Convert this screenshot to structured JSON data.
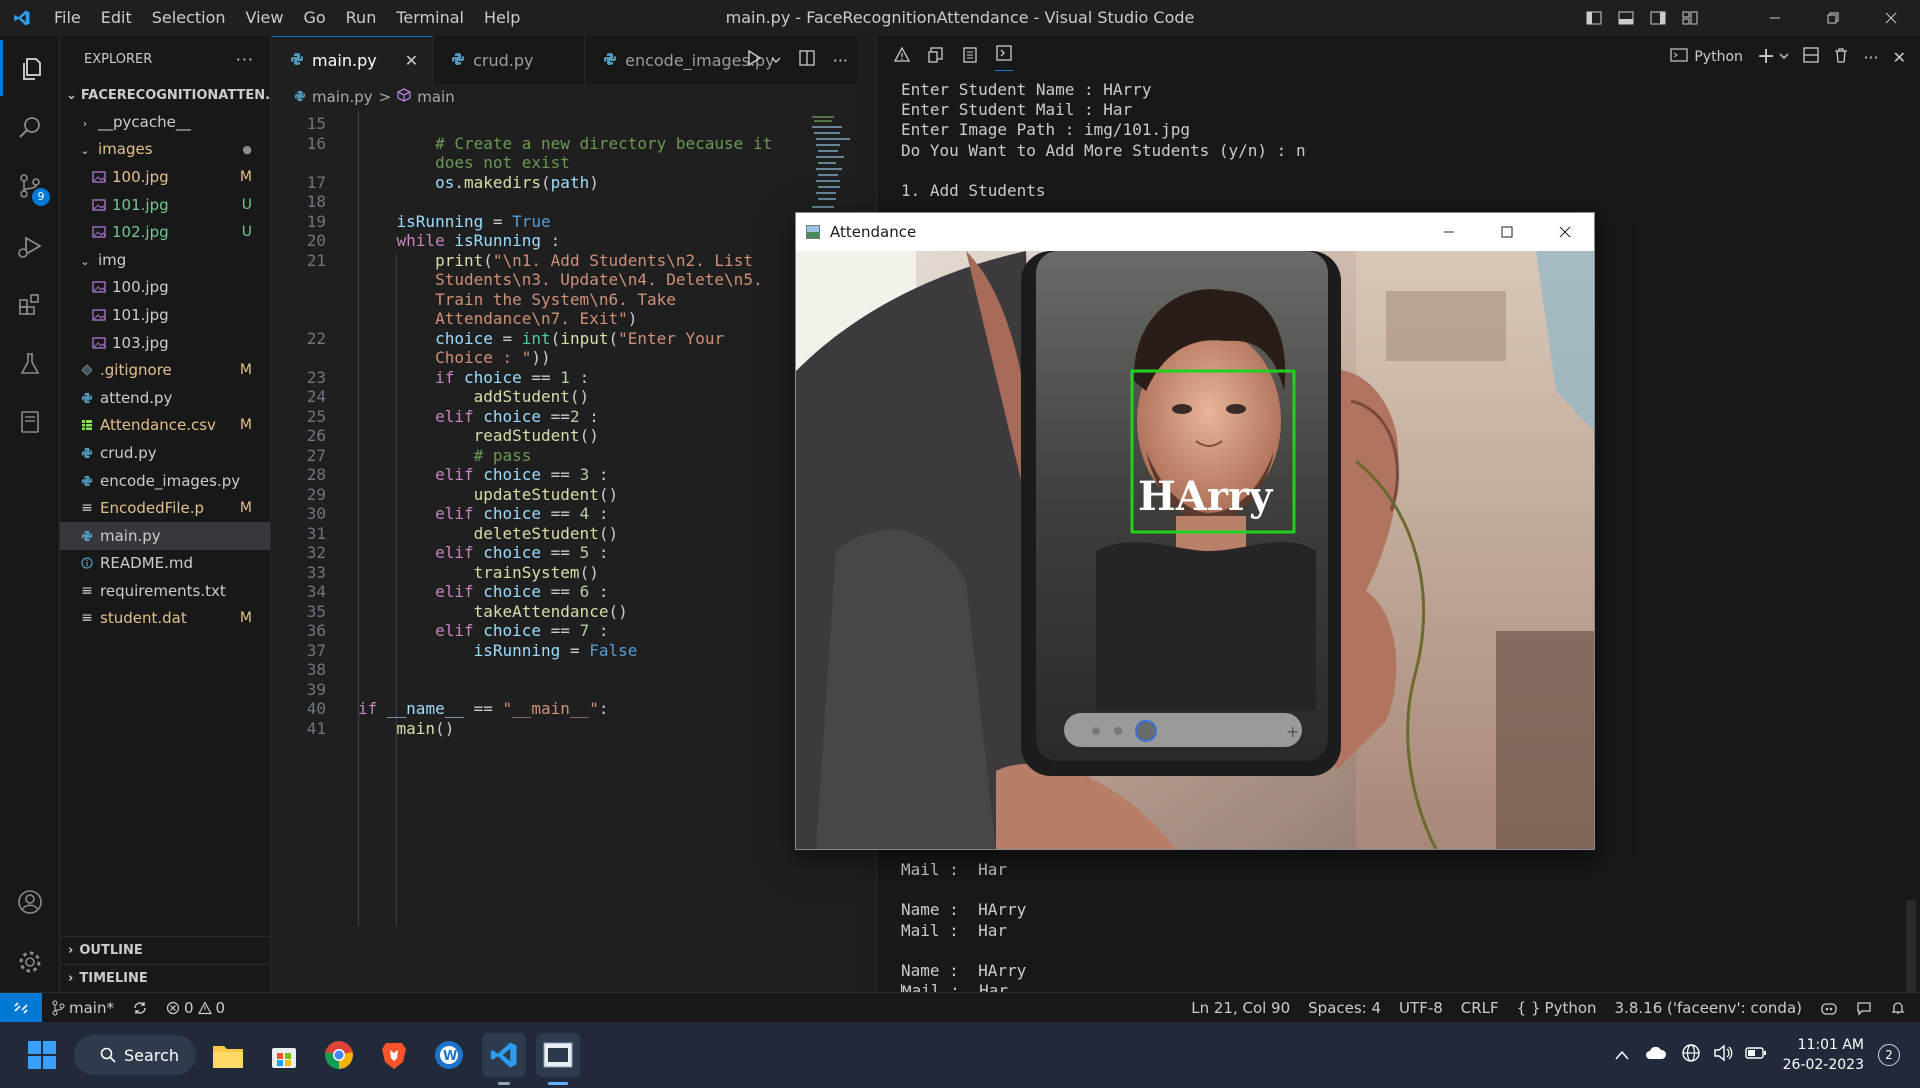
{
  "titlebar": {
    "menu": [
      "File",
      "Edit",
      "Selection",
      "View",
      "Go",
      "Run",
      "Terminal",
      "Help"
    ],
    "title": "main.py - FaceRecognitionAttendance - Visual Studio Code"
  },
  "activity": {
    "scm_badge": "9"
  },
  "explorer": {
    "header": "EXPLORER",
    "more": "···",
    "project": "FACERECOGNITIONATTEN...",
    "items": [
      {
        "label": "__pycache__",
        "status": "",
        "kind": "folder-closed",
        "color": "def"
      },
      {
        "label": "images",
        "status": "●",
        "kind": "folder-open",
        "color": "mod"
      },
      {
        "label": "100.jpg",
        "status": "M",
        "kind": "image",
        "color": "mod"
      },
      {
        "label": "101.jpg",
        "status": "U",
        "kind": "image",
        "color": "untr"
      },
      {
        "label": "102.jpg",
        "status": "U",
        "kind": "image",
        "color": "untr"
      },
      {
        "label": "img",
        "status": "",
        "kind": "folder-open",
        "color": "def"
      },
      {
        "label": "100.jpg",
        "status": "",
        "kind": "image",
        "color": "def"
      },
      {
        "label": "101.jpg",
        "status": "",
        "kind": "image",
        "color": "def"
      },
      {
        "label": "103.jpg",
        "status": "",
        "kind": "image",
        "color": "def"
      },
      {
        "label": ".gitignore",
        "status": "M",
        "kind": "git",
        "color": "mod"
      },
      {
        "label": "attend.py",
        "status": "",
        "kind": "python",
        "color": "def"
      },
      {
        "label": "Attendance.csv",
        "status": "M",
        "kind": "csv",
        "color": "mod"
      },
      {
        "label": "crud.py",
        "status": "",
        "kind": "python",
        "color": "def"
      },
      {
        "label": "encode_images.py",
        "status": "",
        "kind": "python",
        "color": "def"
      },
      {
        "label": "EncodedFile.p",
        "status": "M",
        "kind": "text",
        "color": "mod"
      },
      {
        "label": "main.py",
        "status": "",
        "kind": "python",
        "color": "def"
      },
      {
        "label": "README.md",
        "status": "",
        "kind": "info",
        "color": "def"
      },
      {
        "label": "requirements.txt",
        "status": "",
        "kind": "text",
        "color": "def"
      },
      {
        "label": "student.dat",
        "status": "M",
        "kind": "text",
        "color": "mod"
      }
    ],
    "outline": "OUTLINE",
    "timeline": "TIMELINE"
  },
  "editor": {
    "tabs": [
      {
        "label": "main.py",
        "active": true,
        "close": "✕"
      },
      {
        "label": "crud.py",
        "active": false
      },
      {
        "label": "encode_images.py",
        "active": false
      }
    ],
    "breadcrumb": {
      "file": "main.py",
      "sep": ">",
      "symbol": "main"
    },
    "lines": [
      {
        "num": "15",
        "html": ""
      },
      {
        "num": "16",
        "html": "        <span class='cm'># Create a new directory because it</span>"
      },
      {
        "num": "",
        "html": "        <span class='cm'>does not exist</span>"
      },
      {
        "num": "17",
        "html": "        <span class='v'>os</span>.<span class='f'>makedirs</span>(<span class='v'>path</span>)"
      },
      {
        "num": "18",
        "html": ""
      },
      {
        "num": "19",
        "html": "    <span class='v'>isRunning</span> = <span class='kb'>True</span>"
      },
      {
        "num": "20",
        "html": "    <span class='k'>while</span> <span class='v'>isRunning</span> :"
      },
      {
        "num": "21",
        "html": "        <span class='f'>print</span>(<span class='s'>\"\\n1. Add Students\\n2. List</span>"
      },
      {
        "num": "",
        "html": "        <span class='s'>Students\\n3. Update\\n4. Delete\\n5.</span>"
      },
      {
        "num": "",
        "html": "        <span class='s'>Train the System\\n6. Take</span>"
      },
      {
        "num": "",
        "html": "        <span class='s'>Attendance\\n7. Exit\"</span>)"
      },
      {
        "num": "22",
        "html": "        <span class='v'>choice</span> = <span class='cls'>int</span>(<span class='f'>input</span>(<span class='s'>\"Enter Your</span>"
      },
      {
        "num": "",
        "html": "        <span class='s'>Choice : \"</span>))"
      },
      {
        "num": "23",
        "html": "        <span class='k'>if</span> <span class='v'>choice</span> == <span class='num'>1</span> :"
      },
      {
        "num": "24",
        "html": "            <span class='f'>addStudent</span>()"
      },
      {
        "num": "25",
        "html": "        <span class='k'>elif</span> <span class='v'>choice</span> ==<span class='num'>2</span> :"
      },
      {
        "num": "26",
        "html": "            <span class='f'>readStudent</span>()"
      },
      {
        "num": "27",
        "html": "            <span class='cm'># pass</span>"
      },
      {
        "num": "28",
        "html": "        <span class='k'>elif</span> <span class='v'>choice</span> == <span class='num'>3</span> :"
      },
      {
        "num": "29",
        "html": "            <span class='f'>updateStudent</span>()"
      },
      {
        "num": "30",
        "html": "        <span class='k'>elif</span> <span class='v'>choice</span> == <span class='num'>4</span> :"
      },
      {
        "num": "31",
        "html": "            <span class='f'>deleteStudent</span>()"
      },
      {
        "num": "32",
        "html": "        <span class='k'>elif</span> <span class='v'>choice</span> == <span class='num'>5</span> :"
      },
      {
        "num": "33",
        "html": "            <span class='f'>trainSystem</span>()"
      },
      {
        "num": "34",
        "html": "        <span class='k'>elif</span> <span class='v'>choice</span> == <span class='num'>6</span> :"
      },
      {
        "num": "35",
        "html": "            <span class='f'>takeAttendance</span>()"
      },
      {
        "num": "36",
        "html": "        <span class='k'>elif</span> <span class='v'>choice</span> == <span class='num'>7</span> :"
      },
      {
        "num": "37",
        "html": "            <span class='v'>isRunning</span> = <span class='kb'>False</span>"
      },
      {
        "num": "38",
        "html": ""
      },
      {
        "num": "39",
        "html": ""
      },
      {
        "num": "40",
        "html": "<span class='k'>if</span> <span class='v'>__name__</span> == <span class='s'>\"__main__\"</span>:"
      },
      {
        "num": "41",
        "html": "    <span class='f'>main</span>()"
      }
    ]
  },
  "panel": {
    "shell": "Python",
    "output_top": [
      "Enter Student Name : HArry",
      "Enter Student Mail : Har",
      "Enter Image Path : img/101.jpg",
      "Do You Want to Add More Students (y/n) : n",
      "",
      "1. Add Students"
    ],
    "output_bottom": [
      "Mail :  Har",
      "",
      "Name :  HArry",
      "Mail :  Har",
      "",
      "Name :  HArry",
      "ail :  Har"
    ],
    "cursor_char": "M"
  },
  "attendance_window": {
    "title": "Attendance",
    "detected_name": "HArry"
  },
  "statusbar": {
    "branch": "main*",
    "errors": "0",
    "warnings": "0",
    "position": "Ln 21, Col 90",
    "spaces": "Spaces: 4",
    "encoding": "UTF-8",
    "eol": "CRLF",
    "language": "Python",
    "interpreter": "3.8.16 ('faceenv': conda)"
  },
  "taskbar": {
    "search": "Search",
    "time": "11:01 AM",
    "date": "26-02-2023",
    "notifications": "2"
  },
  "colors": {
    "accent": "#0078d4",
    "face_box": "#1fd21f",
    "modified": "#e2c08d",
    "untracked": "#73c991"
  }
}
